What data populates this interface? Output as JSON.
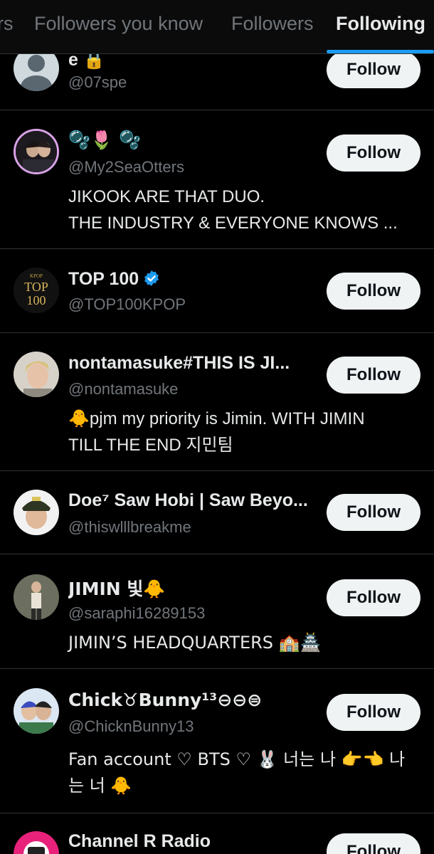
{
  "tabs": {
    "items": [
      {
        "label": "rs"
      },
      {
        "label": "Followers you know"
      },
      {
        "label": "Followers"
      },
      {
        "label": "Following"
      }
    ],
    "active": "Following"
  },
  "follow_label": "Follow",
  "accounts": [
    {
      "name": "e 🔒",
      "handle": "@07spe",
      "bio": "",
      "avatar": "default-avatar-icon"
    },
    {
      "name": "🫧🌷 🫧",
      "handle": "@My2SeaOtters",
      "bio_lines": [
        "JIKOOK ARE THAT DUO.",
        "THE INDUSTRY & EVERYONE KNOWS ..."
      ],
      "avatar": "photo-avatar"
    },
    {
      "name": "TOP 100",
      "verified": true,
      "handle": "@TOP100KPOP",
      "bio": "",
      "avatar": "top100-logo",
      "logo_text": {
        "top": "KPOP",
        "line1": "TOP",
        "line2": "100"
      }
    },
    {
      "name": "nontamasuke#THIS IS JI...",
      "handle": "@nontamasuke",
      "bio_lines": [
        "🐥pjm my priority is Jimin. WITH JIMIN",
        "TILL THE END 지민팀"
      ],
      "avatar": "photo-avatar"
    },
    {
      "name": "Doe⁷ Saw Hobi | Saw Beyo...",
      "handle": "@thiswlllbreakme",
      "bio": "",
      "avatar": "photo-avatar"
    },
    {
      "name": "JIMIN 빛🐥",
      "handle": "@saraphi16289153",
      "bio_lines": [
        "JIMIN’S HEADQUARTERS 🏫🏯"
      ],
      "avatar": "photo-avatar"
    },
    {
      "name": "Chick♉Bunny¹³⊖⊖⊜",
      "handle": "@ChicknBunny13",
      "bio_lines": [
        "Fan account ♡ BTS ♡ 🐰 너는 나 👉👈 나",
        "는 너 🐥"
      ],
      "avatar": "photo-avatar"
    },
    {
      "name": "Channel R Radio",
      "handle": "",
      "bio": "",
      "avatar": "radio-logo"
    }
  ]
}
